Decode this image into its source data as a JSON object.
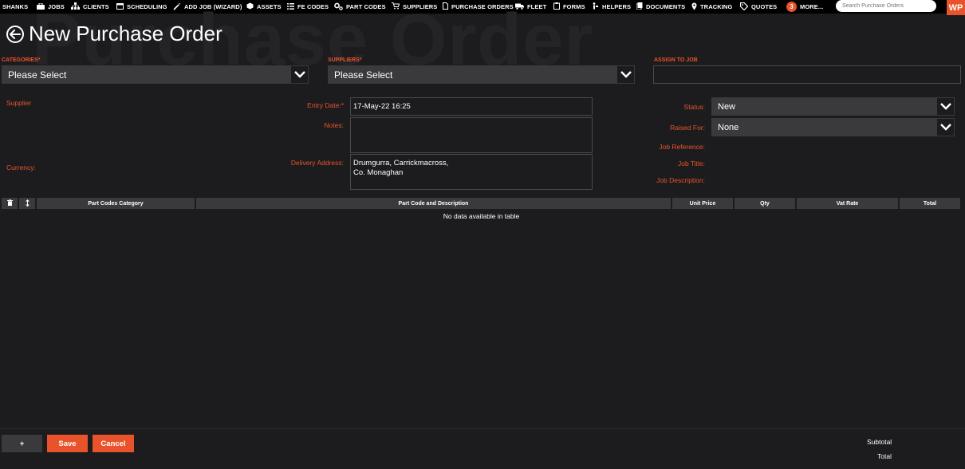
{
  "nav": {
    "items": [
      {
        "label": "SHANKS",
        "icon": ""
      },
      {
        "label": "JOBS",
        "icon": "briefcase-icon"
      },
      {
        "label": "CLIENTS",
        "icon": "sitemap-icon"
      },
      {
        "label": "SCHEDULING",
        "icon": "calendar-icon"
      },
      {
        "label": "ADD JOB (WIZARD)",
        "icon": "wand-icon"
      },
      {
        "label": "ASSETS",
        "icon": "cube-icon"
      },
      {
        "label": "FE CODES",
        "icon": "list-icon"
      },
      {
        "label": "PART CODES",
        "icon": "cogs-icon"
      },
      {
        "label": "SUPPLIERS",
        "icon": "cart-icon"
      },
      {
        "label": "PURCHASE ORDERS",
        "icon": "file-icon"
      },
      {
        "label": "FLEET",
        "icon": "truck-icon"
      },
      {
        "label": "FORMS",
        "icon": "clipboard-icon"
      },
      {
        "label": "HELPERS",
        "icon": "helper-icon"
      },
      {
        "label": "DOCUMENTS",
        "icon": "documents-icon"
      },
      {
        "label": "TRACKING",
        "icon": "map-pin-icon"
      },
      {
        "label": "QUOTES",
        "icon": "tag-icon"
      }
    ],
    "more_badge": "3",
    "more_label": "MORE...",
    "search_placeholder": "Search Purchase Orders",
    "logo_text": "WP"
  },
  "header": {
    "watermark": "Purchase Order",
    "title": "New Purchase Order"
  },
  "top": {
    "categories_label": "CATEGORIES*",
    "categories_value": "Please Select",
    "suppliers_label": "SUPPLIERS*",
    "suppliers_value": "Please Select",
    "assign_label": "ASSIGN TO JOB",
    "assign_value": ""
  },
  "form": {
    "supplier_label": "Supplier",
    "currency_label": "Currency:",
    "entry_date_label": "Entry Date:*",
    "entry_date_value": "17-May-22 16:25",
    "notes_label": "Notes:",
    "notes_value": "",
    "delivery_label": "Delivery Address:",
    "delivery_line1": "Drumgurra, Carrickmacross,",
    "delivery_line2": "Co. Monaghan",
    "status_label": "Status:",
    "status_value": "New",
    "raised_for_label": "Raised For:",
    "raised_for_value": "None",
    "job_reference_label": "Job Reference:",
    "job_title_label": "Job Title:",
    "job_description_label": "Job Description:"
  },
  "table": {
    "columns": [
      "",
      "",
      "Part Codes Category",
      "Part Code and Description",
      "Unit Price",
      "Qty",
      "Vat Rate",
      "Total"
    ],
    "empty_message": "No data available in table"
  },
  "footer": {
    "add_label": "+",
    "save_label": "Save",
    "cancel_label": "Cancel",
    "subtotal_label": "Subtotal",
    "total_label": "Total"
  },
  "colors": {
    "accent": "#e8532b",
    "background": "#1c1c1e",
    "field": "#3a3a3c"
  }
}
